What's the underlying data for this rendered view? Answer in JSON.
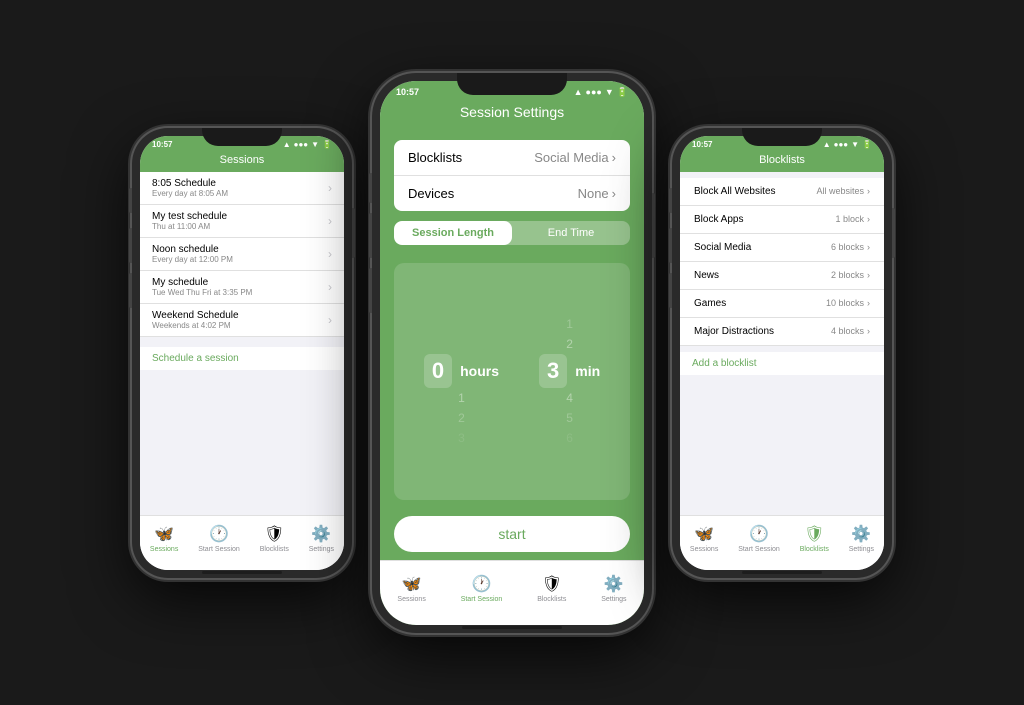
{
  "phones": {
    "left": {
      "status_time": "10:57",
      "header": "Sessions",
      "schedules": [
        {
          "title": "8:05 Schedule",
          "subtitle": "Every day at 8:05 AM"
        },
        {
          "title": "My test schedule",
          "subtitle": "Thu at 11:00 AM"
        },
        {
          "title": "Noon schedule",
          "subtitle": "Every day at 12:00 PM"
        },
        {
          "title": "My schedule",
          "subtitle": "Tue Wed Thu Fri at 3:35 PM"
        },
        {
          "title": "Weekend Schedule",
          "subtitle": "Weekends at 4:02 PM"
        }
      ],
      "action": "Schedule a session",
      "tabs": [
        {
          "label": "Sessions",
          "icon": "🦋",
          "active": true
        },
        {
          "label": "Start Session",
          "icon": "🕐",
          "active": false
        },
        {
          "label": "Blocklists",
          "icon": "🛡",
          "active": false
        },
        {
          "label": "Settings",
          "icon": "⚙️",
          "active": false
        }
      ]
    },
    "middle": {
      "status_time": "10:57",
      "header": "Session Settings",
      "blocklists_label": "Blocklists",
      "blocklists_value": "Social Media",
      "devices_label": "Devices",
      "devices_value": "None",
      "toggle_left": "Session Length",
      "toggle_right": "End Time",
      "picker": {
        "hours_above": [
          "",
          ""
        ],
        "hours_main": "0",
        "hours_below": [
          "1",
          "2",
          "3"
        ],
        "hours_label": "hours",
        "mins_above": [
          "1",
          "2"
        ],
        "mins_main": "3",
        "mins_below": [
          "4",
          "5",
          "6"
        ],
        "mins_label": "min"
      },
      "start_button": "start",
      "tabs": [
        {
          "label": "Sessions",
          "icon": "🦋",
          "active": false
        },
        {
          "label": "Start Session",
          "icon": "🕐",
          "active": true
        },
        {
          "label": "Blocklists",
          "icon": "🛡",
          "active": false
        },
        {
          "label": "Settings",
          "icon": "⚙️",
          "active": false
        }
      ]
    },
    "right": {
      "status_time": "10:57",
      "header": "Blocklists",
      "items": [
        {
          "label": "Block All Websites",
          "value": "All websites"
        },
        {
          "label": "Block Apps",
          "value": "1 block"
        },
        {
          "label": "Social Media",
          "value": "6 blocks"
        },
        {
          "label": "News",
          "value": "2 blocks"
        },
        {
          "label": "Games",
          "value": "10 blocks"
        },
        {
          "label": "Major Distractions",
          "value": "4 blocks"
        }
      ],
      "action": "Add a blocklist",
      "tabs": [
        {
          "label": "Sessions",
          "icon": "🦋",
          "active": false
        },
        {
          "label": "Start Session",
          "icon": "🕐",
          "active": false
        },
        {
          "label": "Blocklists",
          "icon": "🛡",
          "active": true
        },
        {
          "label": "Settings",
          "icon": "⚙️",
          "active": false
        }
      ]
    }
  }
}
